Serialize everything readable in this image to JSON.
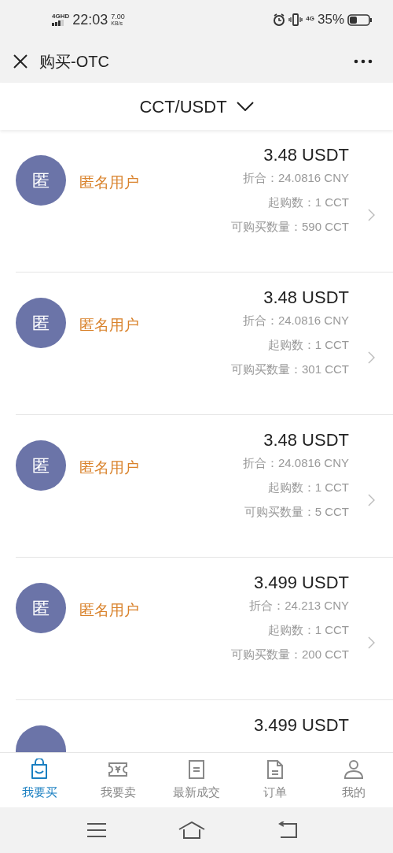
{
  "status_bar": {
    "network": "4GHD",
    "time": "22:03",
    "speed_value": "7.00",
    "speed_unit": "KB/s",
    "mobile": "4G",
    "battery": "35%"
  },
  "header": {
    "title": "购买-OTC"
  },
  "pair_selector": {
    "label": "CCT/USDT"
  },
  "offers": [
    {
      "avatar": "匿",
      "name": "匿名用户",
      "price": "3.48 USDT",
      "converted": "折合：24.0816 CNY",
      "min_buy": "起购数：1 CCT",
      "available": "可购买数量：590 CCT"
    },
    {
      "avatar": "匿",
      "name": "匿名用户",
      "price": "3.48 USDT",
      "converted": "折合：24.0816 CNY",
      "min_buy": "起购数：1 CCT",
      "available": "可购买数量：301 CCT"
    },
    {
      "avatar": "匿",
      "name": "匿名用户",
      "price": "3.48 USDT",
      "converted": "折合：24.0816 CNY",
      "min_buy": "起购数：1 CCT",
      "available": "可购买数量：5 CCT"
    },
    {
      "avatar": "匿",
      "name": "匿名用户",
      "price": "3.499 USDT",
      "converted": "折合：24.213 CNY",
      "min_buy": "起购数：1 CCT",
      "available": "可购买数量：200 CCT"
    },
    {
      "price": "3.499 USDT"
    }
  ],
  "tabs": [
    {
      "kind": "buy",
      "label": "我要买",
      "selected": true
    },
    {
      "kind": "sell",
      "label": "我要卖",
      "selected": false
    },
    {
      "kind": "trades",
      "label": "最新成交",
      "selected": false
    },
    {
      "kind": "orders",
      "label": "订单",
      "selected": false
    },
    {
      "kind": "profile",
      "label": "我的",
      "selected": false
    }
  ]
}
